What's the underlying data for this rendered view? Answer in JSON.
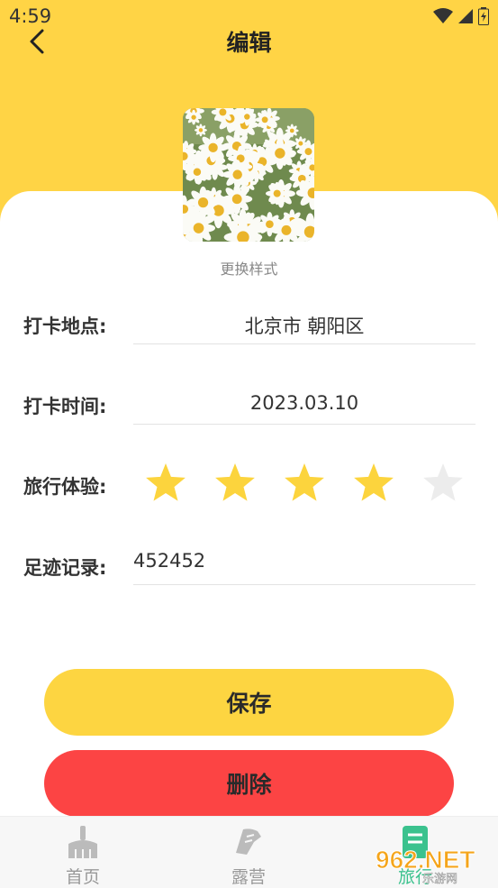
{
  "status_bar": {
    "time": "4:59"
  },
  "header": {
    "title": "编辑"
  },
  "cover": {
    "change_style_label": "更换样式"
  },
  "form": {
    "location": {
      "label": "打卡地点:",
      "value": "北京市 朝阳区"
    },
    "time": {
      "label": "打卡时间:",
      "value": "2023.03.10"
    },
    "rating": {
      "label": "旅行体验:",
      "value": 4,
      "max": 5,
      "filled_color": "#fcd43d",
      "empty_color": "#ececec"
    },
    "record": {
      "label": "足迹记录:",
      "value": "452452"
    }
  },
  "buttons": {
    "save": {
      "label": "保存",
      "color": "#fdd541"
    },
    "delete": {
      "label": "删除",
      "color": "#fc4444"
    }
  },
  "tab_bar": {
    "items": [
      {
        "label": "首页",
        "icon": "broom-icon"
      },
      {
        "label": "露营",
        "icon": "shoe-icon"
      },
      {
        "label": "旅行",
        "icon": "notes-icon",
        "active": true
      }
    ]
  },
  "watermark": {
    "text": "962.NET",
    "sub": "乐游网"
  },
  "colors": {
    "accent": "#ffd445",
    "active_tab": "#3bc28e"
  }
}
